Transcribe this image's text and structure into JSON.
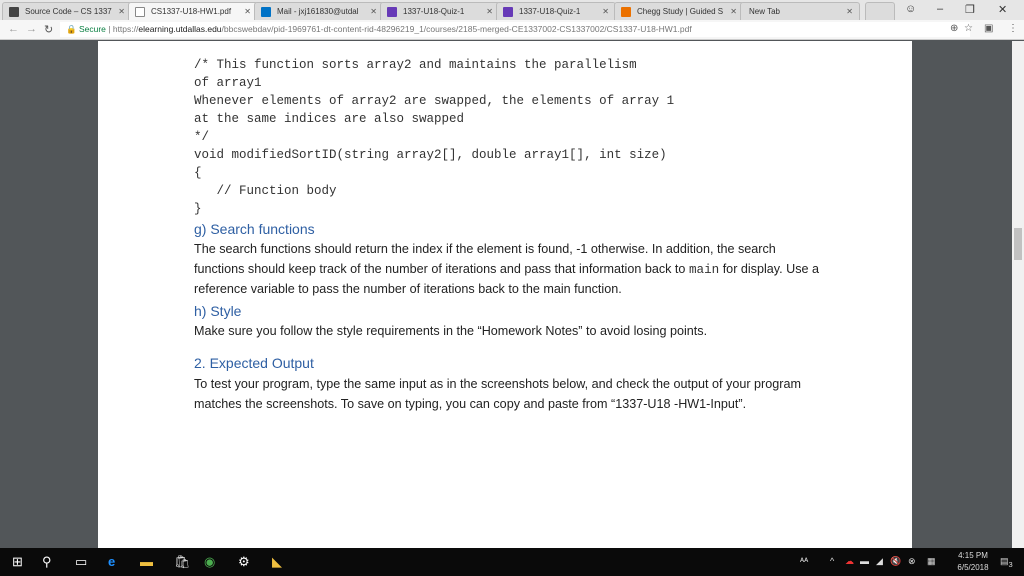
{
  "tabs": [
    {
      "label": "Source Code – CS 1337",
      "icon": "video-icon",
      "color": "#444"
    },
    {
      "label": "CS1337-U18-HW1.pdf",
      "icon": "document-icon",
      "color": "#fff",
      "active": true
    },
    {
      "label": "Mail - jxj161830@utdal",
      "icon": "outlook-icon",
      "color": "#0072c6"
    },
    {
      "label": "1337-U18-Quiz-1",
      "icon": "forms-icon",
      "color": "#673ab7"
    },
    {
      "label": "1337-U18-Quiz-1",
      "icon": "forms-icon",
      "color": "#673ab7"
    },
    {
      "label": "Chegg Study | Guided S",
      "icon": "chegg-icon",
      "color": "#eb7100"
    },
    {
      "label": "New Tab",
      "icon": "",
      "color": ""
    }
  ],
  "address": {
    "secure": "Secure",
    "scheme": "https://",
    "domain": "elearning.utdallas.edu",
    "path": "/bbcswebdav/pid-1969761-dt-content-rid-48296219_1/courses/2185-merged-CE1337002-CS1337002/CS1337-U18-HW1.pdf"
  },
  "doc": {
    "code": [
      "/* This function sorts array2 and maintains the parallelism",
      "of array1",
      "Whenever elements of array2 are swapped, the elements of array 1",
      "at the same indices are also swapped",
      "*/",
      "void modifiedSortID(string array2[], double array1[], int size)",
      "{",
      "   // Function body",
      "}"
    ],
    "g_heading": "g)  Search functions",
    "g_text": "The search functions should return the index if the element is found, -1 otherwise. In addition, the search functions should keep track of the number of iterations and pass that information back to",
    "g_code": "main",
    "g_text2": "for display. Use a reference variable to pass the number of iterations back to the main function.",
    "h_heading": "h)  Style",
    "h_text": "Make sure you follow the style requirements in the “Homework Notes” to avoid losing points.",
    "s2_heading": "2.  Expected Output",
    "s2_text": "To test your program, type the same input as in the screenshots below, and check the output of your program matches the screenshots. To save on typing, you can copy and paste from “1337-U18 -HW1-Input”."
  },
  "taskbar": {
    "time": "4:15 PM",
    "date": "6/5/2018",
    "notifications": "3"
  }
}
